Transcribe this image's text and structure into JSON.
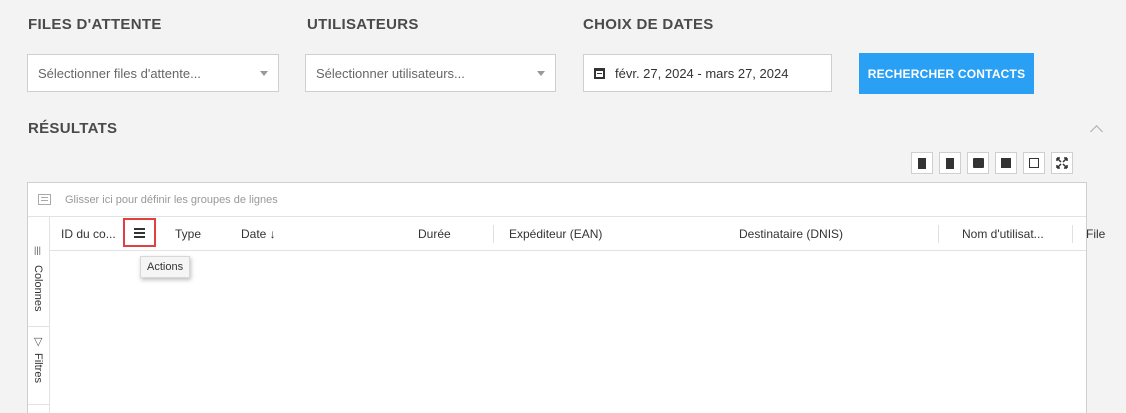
{
  "filters": {
    "queues": {
      "title": "FILES D'ATTENTE",
      "placeholder": "Sélectionner files d'attente..."
    },
    "users": {
      "title": "UTILISATEURS",
      "placeholder": "Sélectionner utilisateurs..."
    },
    "dates": {
      "title": "CHOIX DE DATES",
      "value": "févr. 27, 2024 - mars 27, 2024"
    },
    "search_label": "RECHERCHER CONTACTS"
  },
  "results": {
    "title": "RÉSULTATS",
    "toolbar_icons": [
      "export-excel-icon",
      "export-csv-icon",
      "save-icon",
      "copy-icon",
      "restore-icon",
      "fullscreen-icon"
    ],
    "group_hint": "Glisser ici pour définir les groupes de lignes",
    "side_tabs": [
      "Colonnes",
      "Filtres"
    ],
    "columns": [
      "ID du co...",
      "Type",
      "Date ↓",
      "Durée",
      "Expéditeur (EAN)",
      "Destinataire (DNIS)",
      "Nom d'utilisat...",
      "File"
    ],
    "actions_tooltip": "Actions"
  },
  "colors": {
    "accent": "#2aa0f5",
    "highlight": "#e24040"
  }
}
